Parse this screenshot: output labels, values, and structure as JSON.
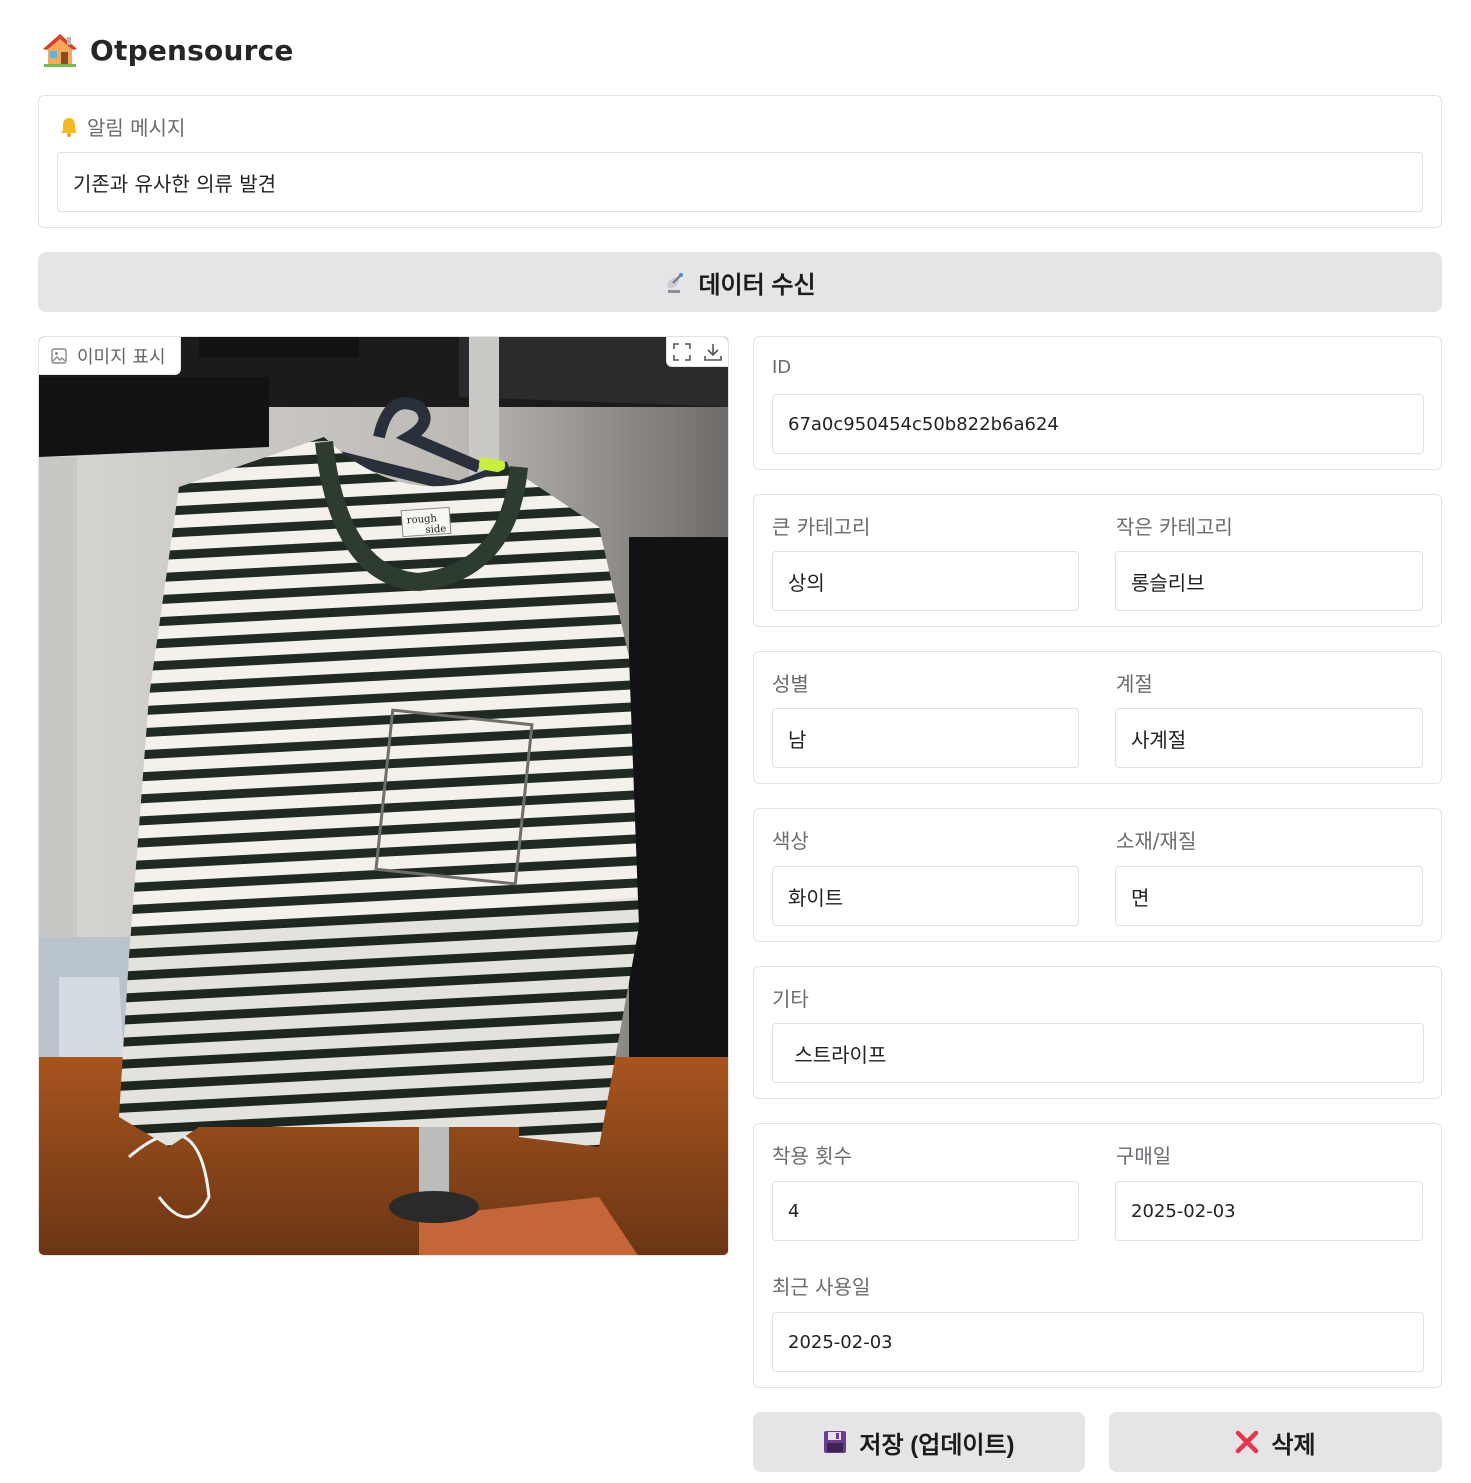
{
  "header": {
    "title": "Otpensource",
    "icon": "house-emoji"
  },
  "notice": {
    "label": "알림 메시지",
    "value": "기존과 유사한 의류 발견"
  },
  "receive_button": {
    "label": "데이터 수신",
    "icon": "satellite-dish-icon"
  },
  "image_panel": {
    "label": "이미지 표시",
    "tools": [
      "fullscreen-icon",
      "download-icon"
    ]
  },
  "fields": {
    "id": {
      "label": "ID",
      "value": "67a0c950454c50b822b6a624"
    },
    "big_category": {
      "label": "큰 카테고리",
      "value": "상의"
    },
    "small_category": {
      "label": "작은 카테고리",
      "value": "롱슬리브"
    },
    "gender": {
      "label": "성별",
      "value": "남"
    },
    "season": {
      "label": "계절",
      "value": "사계절"
    },
    "color": {
      "label": "색상",
      "value": "화이트"
    },
    "material": {
      "label": "소재/재질",
      "value": "면"
    },
    "etc": {
      "label": "기타",
      "value": " 스트라이프"
    },
    "wear_count": {
      "label": "착용 횟수",
      "value": "4"
    },
    "purchase_date": {
      "label": "구매일",
      "value": "2025-02-03"
    },
    "last_used": {
      "label": "최근 사용일",
      "value": "2025-02-03"
    }
  },
  "actions": {
    "save_label": "저장 (업데이트)",
    "delete_label": "삭제"
  },
  "photo": {
    "tag_text_top": "rough",
    "tag_text_bottom": "side"
  },
  "colors": {
    "button_bg": "#e5e5e8",
    "delete_icon": "#e8344e",
    "save_icon": "#6a3d8f"
  }
}
